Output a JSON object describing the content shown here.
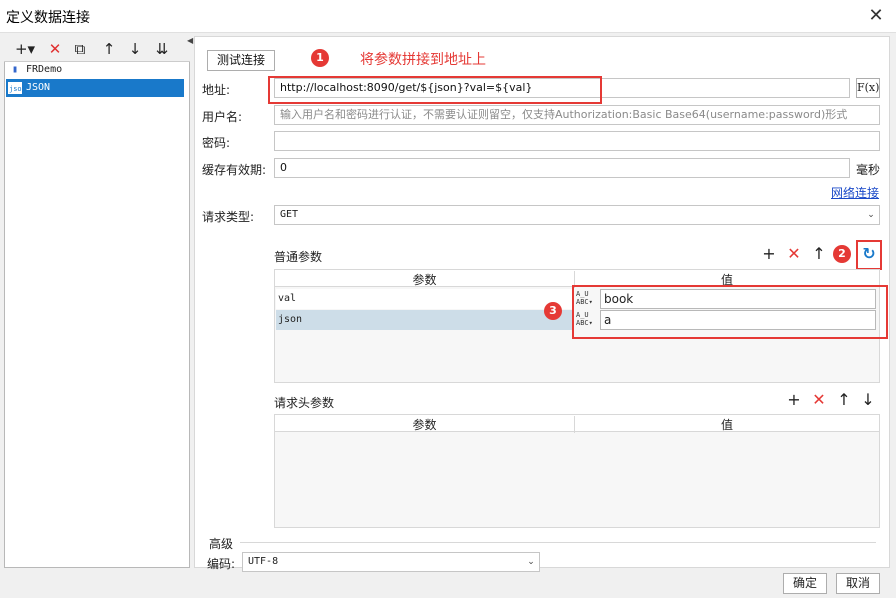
{
  "window": {
    "title": "定义数据连接",
    "close_glyph": "✕"
  },
  "left_toolbar": {
    "add_glyph": "+▾",
    "delete_glyph": "✕",
    "copy_glyph": "⧉",
    "up_glyph": "↑",
    "down_glyph": "↓",
    "move_glyph": "⇊"
  },
  "splitter_glyph": "◀",
  "connections": [
    {
      "name": "FRDemo",
      "icon": "database-icon",
      "icon_glyph": "▮",
      "selected": false
    },
    {
      "name": "JSON",
      "icon": "json-icon",
      "icon_glyph": "json",
      "selected": true
    }
  ],
  "test_button_label": "测试连接",
  "form": {
    "address_label": "地址:",
    "address_value": "http://localhost:8090/get/${json}?val=${val}",
    "fx_label": "F(x)",
    "username_label": "用户名:",
    "username_placeholder": "输入用户名和密码进行认证，不需要认证则留空，仅支持Authorization:Basic Base64(username:password)形式",
    "password_label": "密码:",
    "password_value": "",
    "cache_label": "缓存有效期:",
    "cache_value": "0",
    "cache_unit": "毫秒",
    "network_link": "网络连接",
    "method_label": "请求类型:",
    "method_value": "GET",
    "dropdown_glyph": "⌄"
  },
  "params": {
    "section_label": "普通参数",
    "col_param": "参数",
    "col_value": "值",
    "rows": [
      {
        "name": "val",
        "value": "book"
      },
      {
        "name": "json",
        "value": "a"
      }
    ],
    "add_glyph": "+",
    "delete_glyph": "✕",
    "up_glyph": "↑",
    "refresh_glyph": "↻",
    "type_icon_text": "A̲U\nABC▾"
  },
  "headers": {
    "section_label": "请求头参数",
    "col_param": "参数",
    "col_value": "值",
    "add_glyph": "+",
    "delete_glyph": "✕",
    "up_glyph": "↑",
    "down_glyph": "↓"
  },
  "advanced": {
    "label": "高级",
    "encoding_label": "编码:",
    "encoding_value": "UTF-8"
  },
  "footer": {
    "ok_label": "确定",
    "cancel_label": "取消"
  },
  "annotations": {
    "step1_number": "1",
    "step1_text": "将参数拼接到地址上",
    "step2_number": "2",
    "step3_number": "3"
  },
  "colors": {
    "accent": "#e53935",
    "selection": "#1979ca",
    "link": "#1a49c8"
  }
}
